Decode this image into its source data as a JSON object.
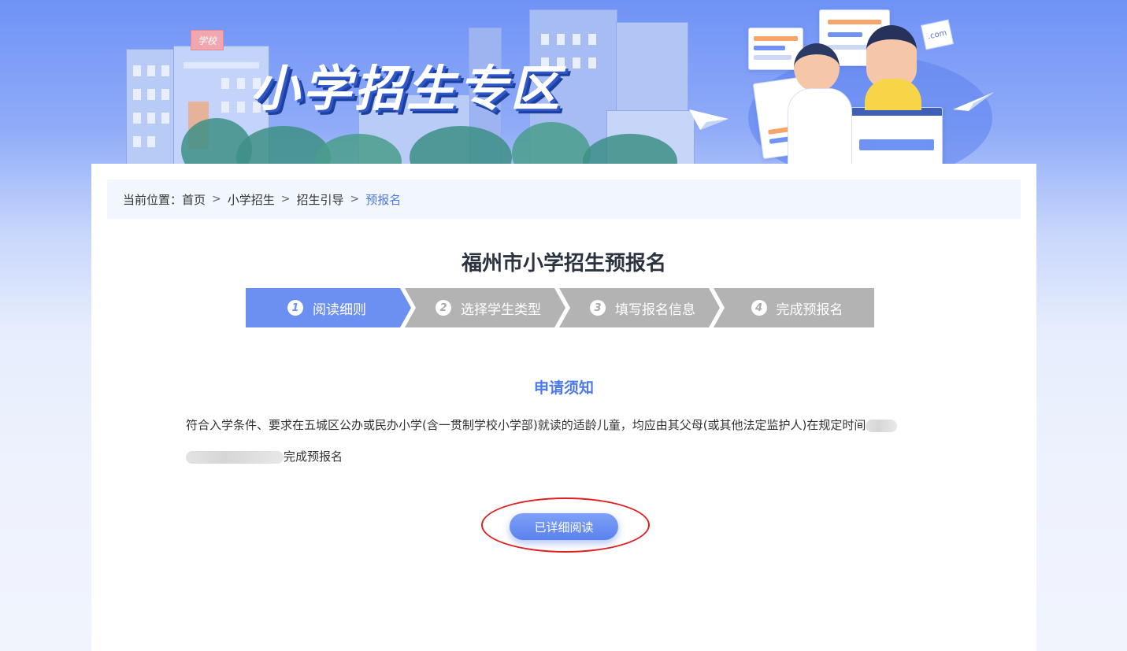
{
  "banner": {
    "title": "小学招生专区",
    "school_sign": "学校",
    "web_badge": ".com"
  },
  "breadcrumb": {
    "prefix": "当前位置：",
    "items": [
      "首页",
      "小学招生",
      "招生引导",
      "预报名"
    ]
  },
  "page_title": "福州市小学招生预报名",
  "steps": [
    {
      "num": "1",
      "label": "阅读细则",
      "active": true
    },
    {
      "num": "2",
      "label": "选择学生类型",
      "active": false
    },
    {
      "num": "3",
      "label": "填写报名信息",
      "active": false
    },
    {
      "num": "4",
      "label": "完成预报名",
      "active": false
    }
  ],
  "notice": {
    "title": "申请须知",
    "text_part1": "符合入学条件、要求在五城区公办或民办小学(含一贯制学校小学部)就读的适龄儿童，均应由其父母(或其他法定监护人)在规定时间",
    "text_part2": "完成预报名"
  },
  "confirm_button": "已详细阅读",
  "colors": {
    "accent": "#4d79e8",
    "step_active": "#6c8ff2",
    "step_inactive": "#b3b3b3",
    "annotation": "#e02020"
  }
}
